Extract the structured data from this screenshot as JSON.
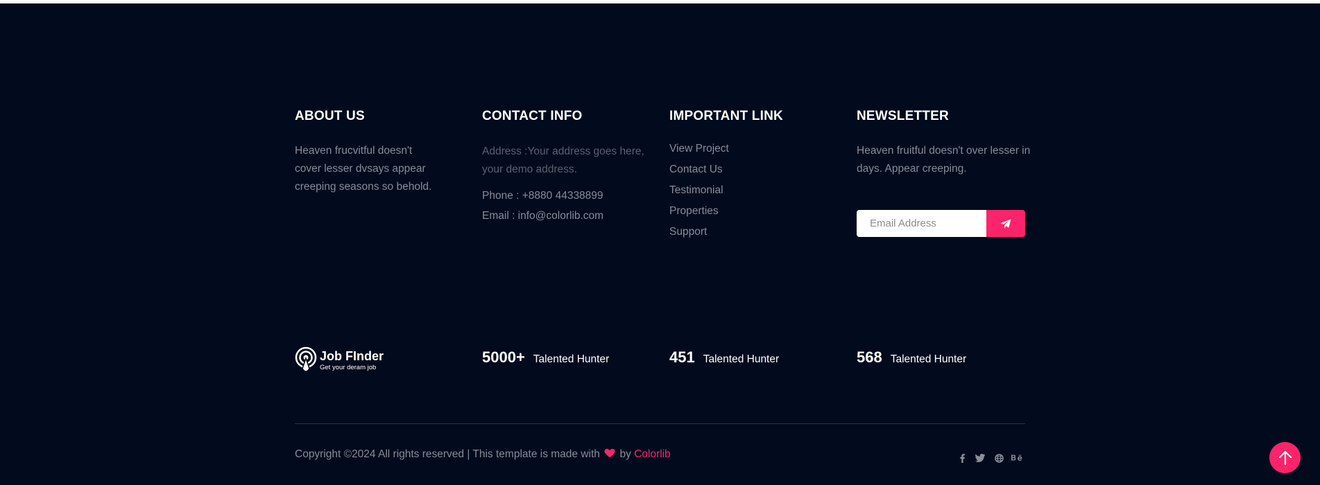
{
  "about": {
    "title": "ABOUT US",
    "lines": [
      "Heaven frucvitful doesn't",
      "cover lesser dvsays appear",
      "creeping seasons so behold."
    ]
  },
  "contact": {
    "title": "CONTACT INFO",
    "address_lines": [
      "Address :Your address goes here,",
      "your demo address."
    ],
    "phone": "Phone : +8880 44338899",
    "email": "Email : info@colorlib.com"
  },
  "links": {
    "title": "IMPORTANT LINK",
    "items": [
      "View Project",
      "Contact Us",
      "Testimonial",
      "Properties",
      "Support"
    ]
  },
  "newsletter": {
    "title": "NEWSLETTER",
    "lines": [
      "Heaven fruitful doesn't over lesser in",
      "days. Appear creeping."
    ],
    "placeholder": "Email Address",
    "button_icon": "paper-plane-icon"
  },
  "logo": {
    "name": "Job FInder",
    "tagline": "Get your deram job"
  },
  "stats": [
    {
      "number": "5000+",
      "label": "Talented Hunter"
    },
    {
      "number": "451",
      "label": "Talented Hunter"
    },
    {
      "number": "568",
      "label": "Talented Hunter"
    }
  ],
  "copyright": {
    "text": "Copyright ©2024 All rights reserved | This template is made with",
    "by": "by",
    "brand": "Colorlib"
  },
  "social": [
    "facebook-icon",
    "twitter-icon",
    "globe-icon",
    "behance-icon"
  ],
  "colors": {
    "background": "#010b1d",
    "accent": "#fb246a",
    "text_muted": "#868c98"
  }
}
